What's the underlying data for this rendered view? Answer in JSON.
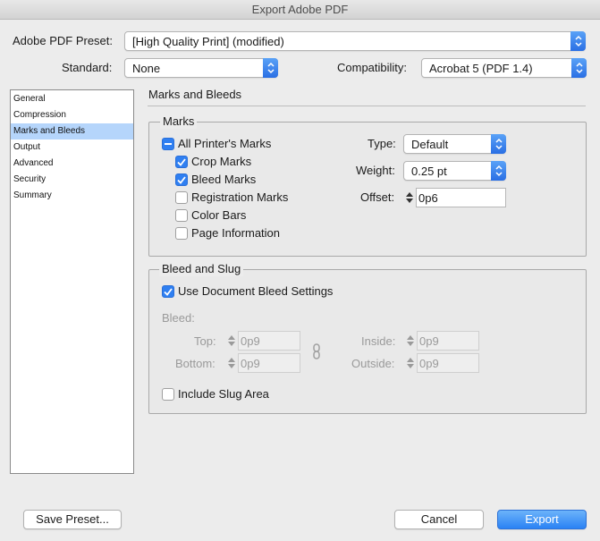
{
  "window": {
    "title": "Export Adobe PDF"
  },
  "preset": {
    "label": "Adobe PDF Preset:",
    "value": "[High Quality Print] (modified)"
  },
  "standard": {
    "label": "Standard:",
    "value": "None"
  },
  "compatibility": {
    "label": "Compatibility:",
    "value": "Acrobat 5 (PDF 1.4)"
  },
  "sidebar": {
    "items": [
      {
        "label": "General"
      },
      {
        "label": "Compression"
      },
      {
        "label": "Marks and Bleeds"
      },
      {
        "label": "Output"
      },
      {
        "label": "Advanced"
      },
      {
        "label": "Security"
      },
      {
        "label": "Summary"
      }
    ],
    "selected": "Marks and Bleeds"
  },
  "panel": {
    "title": "Marks and Bleeds"
  },
  "marks": {
    "title": "Marks",
    "all_printers_marks": "All Printer's Marks",
    "items": [
      {
        "label": "Crop Marks",
        "checked": true
      },
      {
        "label": "Bleed Marks",
        "checked": true
      },
      {
        "label": "Registration Marks",
        "checked": false
      },
      {
        "label": "Color Bars",
        "checked": false
      },
      {
        "label": "Page Information",
        "checked": false
      }
    ],
    "type": {
      "label": "Type:",
      "value": "Default"
    },
    "weight": {
      "label": "Weight:",
      "value": "0.25 pt"
    },
    "offset": {
      "label": "Offset:",
      "value": "0p6"
    }
  },
  "bleed_slug": {
    "title": "Bleed and Slug",
    "use_document_bleed": {
      "label": "Use Document Bleed Settings",
      "checked": true
    },
    "bleed_label": "Bleed:",
    "top": {
      "label": "Top:",
      "value": "0p9"
    },
    "bottom": {
      "label": "Bottom:",
      "value": "0p9"
    },
    "inside": {
      "label": "Inside:",
      "value": "0p9"
    },
    "outside": {
      "label": "Outside:",
      "value": "0p9"
    },
    "include_slug": {
      "label": "Include Slug Area",
      "checked": false
    }
  },
  "footer": {
    "save_preset": "Save Preset...",
    "cancel": "Cancel",
    "export": "Export"
  },
  "colors": {
    "accent": "#2f7ff1",
    "selection": "#b5d5fb"
  }
}
